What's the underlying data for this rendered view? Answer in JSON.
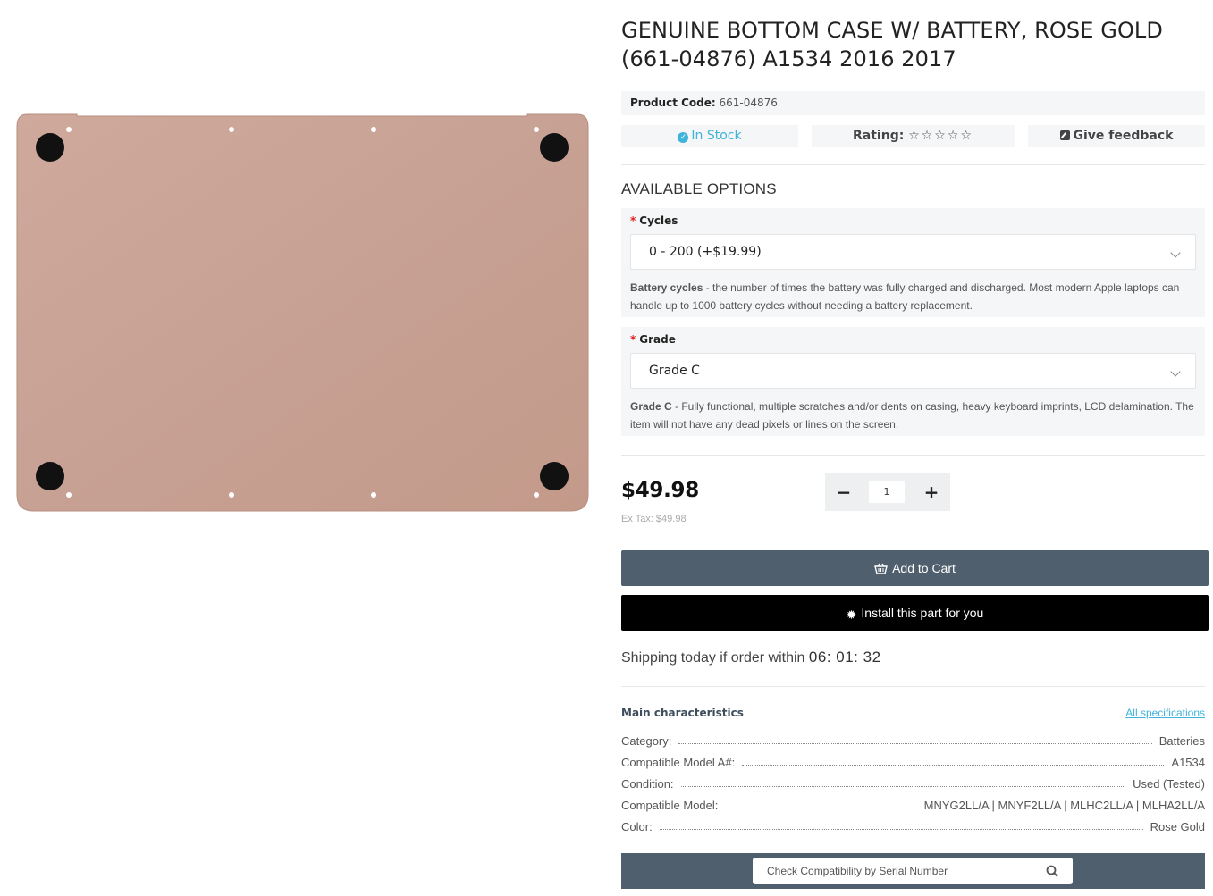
{
  "product": {
    "title": "GENUINE BOTTOM CASE W/ BATTERY, ROSE GOLD (661-04876) A1534 2016 2017",
    "image_alt": "Rose gold bottom case",
    "code_label": "Product Code:",
    "code_value": "661-04876",
    "stock": "In Stock",
    "rating_label": "Rating:",
    "rating_value": 0,
    "rating_max": 5,
    "feedback": "Give feedback"
  },
  "options": {
    "heading": "AVAILABLE OPTIONS",
    "cycles": {
      "required_mark": "*",
      "label": "Cycles",
      "selected": "0 - 200 (+$19.99)",
      "desc_term": "Battery cycles",
      "desc_text": " - the number of times the battery was fully charged and discharged. Most modern Apple laptops can handle up to 1000 battery cycles without needing a battery replacement."
    },
    "grade": {
      "required_mark": "*",
      "label": "Grade",
      "selected": "Grade C",
      "desc_term": "Grade C",
      "desc_text": " - Fully functional, multiple scratches and/or dents on casing, heavy keyboard imprints, LCD delamination. The item will not have any dead pixels or lines on the screen."
    }
  },
  "purchase": {
    "price": "$49.98",
    "ex_tax": "Ex Tax: $49.98",
    "qty_minus": "−",
    "qty_plus": "+",
    "qty_value": "1",
    "add_to_cart": "Add to Cart",
    "install": "Install this part for you"
  },
  "shipping": {
    "text": "Shipping today if order within",
    "timer": "06: 01: 32"
  },
  "characteristics": {
    "title": "Main characteristics",
    "all_link": "All specifications",
    "rows": [
      {
        "k": "Category:",
        "v": "Batteries"
      },
      {
        "k": "Compatible Model A#:",
        "v": "A1534"
      },
      {
        "k": "Condition:",
        "v": "Used (Tested)"
      },
      {
        "k": "Compatible Model:",
        "v": "MNYG2LL/A | MNYF2LL/A | MLHC2LL/A | MLHA2LL/A"
      },
      {
        "k": "Color:",
        "v": "Rose Gold"
      }
    ]
  },
  "compat": {
    "placeholder": "Check Compatibility by Serial Number"
  },
  "colors": {
    "accent": "#3fb3d9",
    "dark_button": "#4f5f6d",
    "install_button": "#000000",
    "required": "#e02020",
    "case_color": "#c79e91"
  },
  "icons": {
    "stock": "check-circle-icon",
    "feedback": "edit-icon",
    "cart": "basket-icon",
    "install": "gear-icon",
    "search": "search-icon"
  }
}
